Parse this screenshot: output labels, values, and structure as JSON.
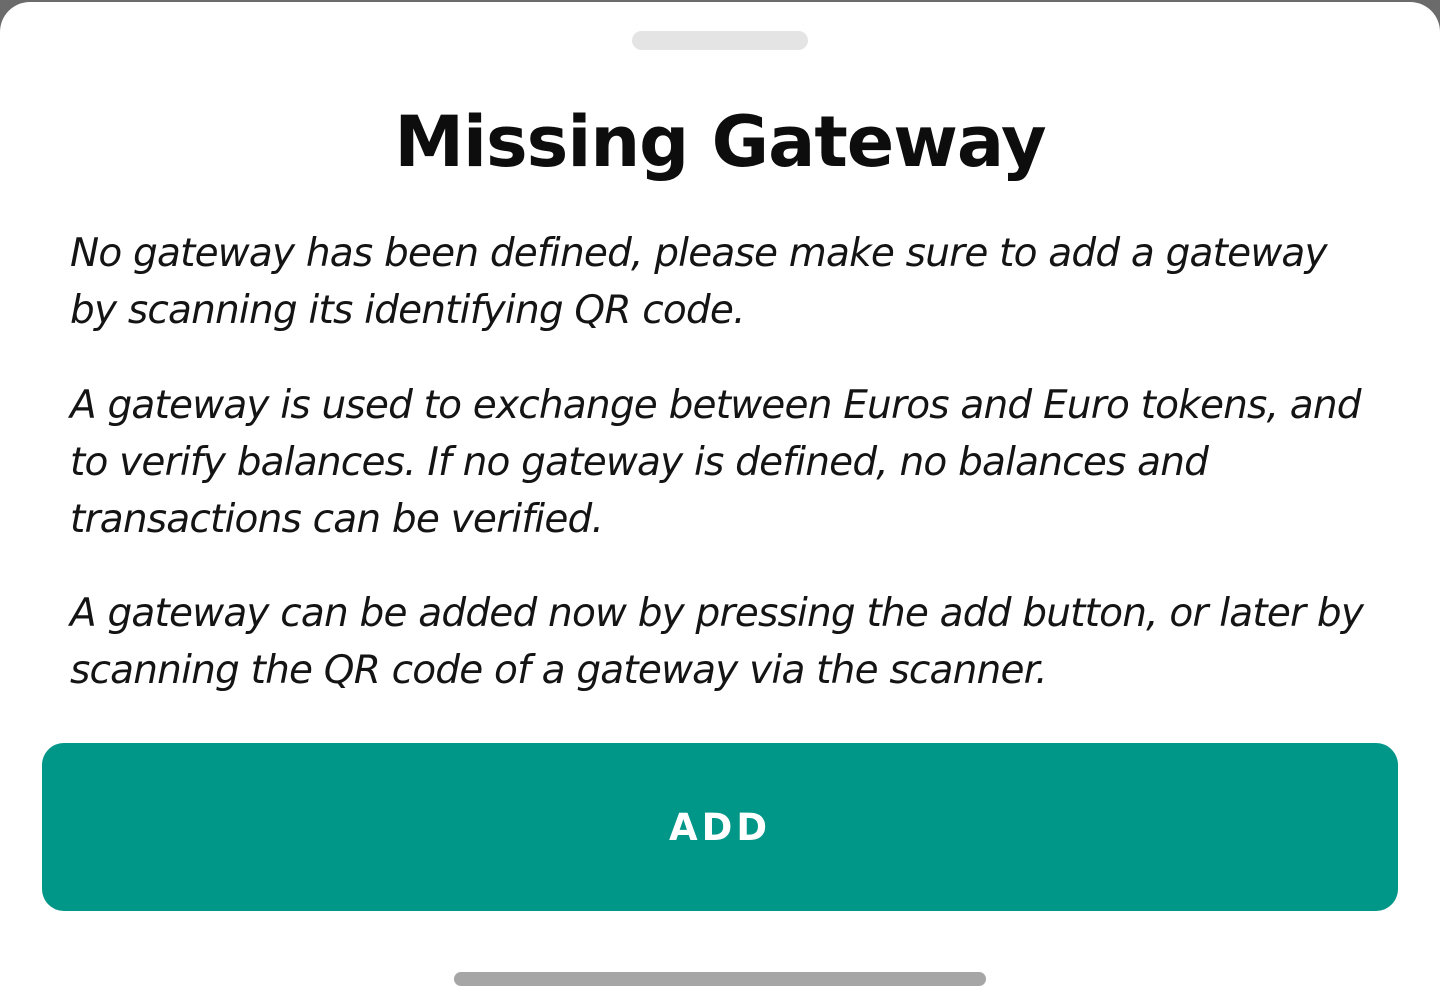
{
  "dialog": {
    "title": "Missing Gateway",
    "paragraphs": [
      "No gateway has been defined, please make sure to add a gateway by scanning its identifying QR code.",
      "A gateway is used to exchange between Euros and Euro tokens, and to verify balances. If no gateway is defined, no balances and transactions can be verified.",
      "A gateway can be added now by pressing the add button, or later by scanning the QR code of a gateway via the scanner."
    ],
    "add_button_label": "ADD"
  },
  "colors": {
    "accent": "#009688",
    "background": "#ffffff",
    "text": "#111111"
  }
}
